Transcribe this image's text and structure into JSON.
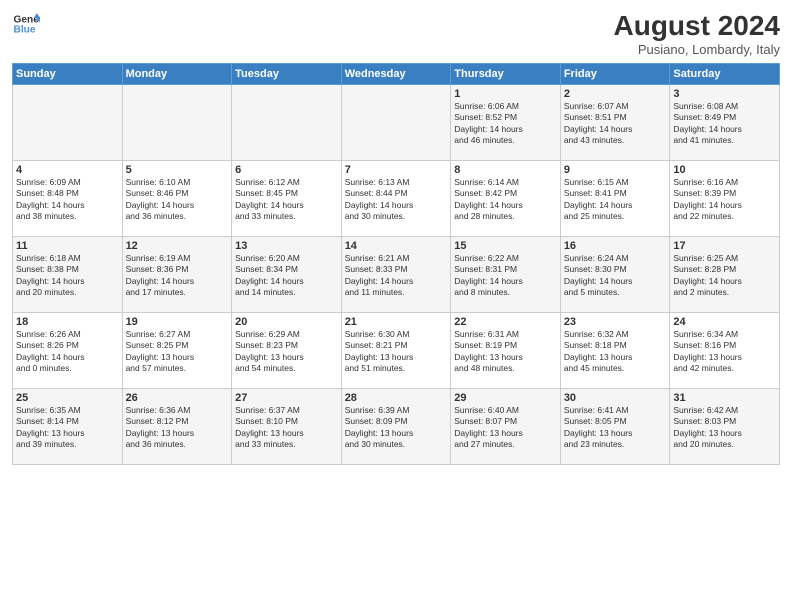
{
  "header": {
    "logo_line1": "General",
    "logo_line2": "Blue",
    "month_year": "August 2024",
    "location": "Pusiano, Lombardy, Italy"
  },
  "weekdays": [
    "Sunday",
    "Monday",
    "Tuesday",
    "Wednesday",
    "Thursday",
    "Friday",
    "Saturday"
  ],
  "weeks": [
    [
      {
        "day": "",
        "info": ""
      },
      {
        "day": "",
        "info": ""
      },
      {
        "day": "",
        "info": ""
      },
      {
        "day": "",
        "info": ""
      },
      {
        "day": "1",
        "info": "Sunrise: 6:06 AM\nSunset: 8:52 PM\nDaylight: 14 hours\nand 46 minutes."
      },
      {
        "day": "2",
        "info": "Sunrise: 6:07 AM\nSunset: 8:51 PM\nDaylight: 14 hours\nand 43 minutes."
      },
      {
        "day": "3",
        "info": "Sunrise: 6:08 AM\nSunset: 8:49 PM\nDaylight: 14 hours\nand 41 minutes."
      }
    ],
    [
      {
        "day": "4",
        "info": "Sunrise: 6:09 AM\nSunset: 8:48 PM\nDaylight: 14 hours\nand 38 minutes."
      },
      {
        "day": "5",
        "info": "Sunrise: 6:10 AM\nSunset: 8:46 PM\nDaylight: 14 hours\nand 36 minutes."
      },
      {
        "day": "6",
        "info": "Sunrise: 6:12 AM\nSunset: 8:45 PM\nDaylight: 14 hours\nand 33 minutes."
      },
      {
        "day": "7",
        "info": "Sunrise: 6:13 AM\nSunset: 8:44 PM\nDaylight: 14 hours\nand 30 minutes."
      },
      {
        "day": "8",
        "info": "Sunrise: 6:14 AM\nSunset: 8:42 PM\nDaylight: 14 hours\nand 28 minutes."
      },
      {
        "day": "9",
        "info": "Sunrise: 6:15 AM\nSunset: 8:41 PM\nDaylight: 14 hours\nand 25 minutes."
      },
      {
        "day": "10",
        "info": "Sunrise: 6:16 AM\nSunset: 8:39 PM\nDaylight: 14 hours\nand 22 minutes."
      }
    ],
    [
      {
        "day": "11",
        "info": "Sunrise: 6:18 AM\nSunset: 8:38 PM\nDaylight: 14 hours\nand 20 minutes."
      },
      {
        "day": "12",
        "info": "Sunrise: 6:19 AM\nSunset: 8:36 PM\nDaylight: 14 hours\nand 17 minutes."
      },
      {
        "day": "13",
        "info": "Sunrise: 6:20 AM\nSunset: 8:34 PM\nDaylight: 14 hours\nand 14 minutes."
      },
      {
        "day": "14",
        "info": "Sunrise: 6:21 AM\nSunset: 8:33 PM\nDaylight: 14 hours\nand 11 minutes."
      },
      {
        "day": "15",
        "info": "Sunrise: 6:22 AM\nSunset: 8:31 PM\nDaylight: 14 hours\nand 8 minutes."
      },
      {
        "day": "16",
        "info": "Sunrise: 6:24 AM\nSunset: 8:30 PM\nDaylight: 14 hours\nand 5 minutes."
      },
      {
        "day": "17",
        "info": "Sunrise: 6:25 AM\nSunset: 8:28 PM\nDaylight: 14 hours\nand 2 minutes."
      }
    ],
    [
      {
        "day": "18",
        "info": "Sunrise: 6:26 AM\nSunset: 8:26 PM\nDaylight: 14 hours\nand 0 minutes."
      },
      {
        "day": "19",
        "info": "Sunrise: 6:27 AM\nSunset: 8:25 PM\nDaylight: 13 hours\nand 57 minutes."
      },
      {
        "day": "20",
        "info": "Sunrise: 6:29 AM\nSunset: 8:23 PM\nDaylight: 13 hours\nand 54 minutes."
      },
      {
        "day": "21",
        "info": "Sunrise: 6:30 AM\nSunset: 8:21 PM\nDaylight: 13 hours\nand 51 minutes."
      },
      {
        "day": "22",
        "info": "Sunrise: 6:31 AM\nSunset: 8:19 PM\nDaylight: 13 hours\nand 48 minutes."
      },
      {
        "day": "23",
        "info": "Sunrise: 6:32 AM\nSunset: 8:18 PM\nDaylight: 13 hours\nand 45 minutes."
      },
      {
        "day": "24",
        "info": "Sunrise: 6:34 AM\nSunset: 8:16 PM\nDaylight: 13 hours\nand 42 minutes."
      }
    ],
    [
      {
        "day": "25",
        "info": "Sunrise: 6:35 AM\nSunset: 8:14 PM\nDaylight: 13 hours\nand 39 minutes."
      },
      {
        "day": "26",
        "info": "Sunrise: 6:36 AM\nSunset: 8:12 PM\nDaylight: 13 hours\nand 36 minutes."
      },
      {
        "day": "27",
        "info": "Sunrise: 6:37 AM\nSunset: 8:10 PM\nDaylight: 13 hours\nand 33 minutes."
      },
      {
        "day": "28",
        "info": "Sunrise: 6:39 AM\nSunset: 8:09 PM\nDaylight: 13 hours\nand 30 minutes."
      },
      {
        "day": "29",
        "info": "Sunrise: 6:40 AM\nSunset: 8:07 PM\nDaylight: 13 hours\nand 27 minutes."
      },
      {
        "day": "30",
        "info": "Sunrise: 6:41 AM\nSunset: 8:05 PM\nDaylight: 13 hours\nand 23 minutes."
      },
      {
        "day": "31",
        "info": "Sunrise: 6:42 AM\nSunset: 8:03 PM\nDaylight: 13 hours\nand 20 minutes."
      }
    ]
  ]
}
